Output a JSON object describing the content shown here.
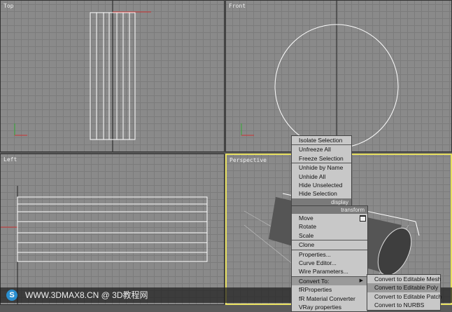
{
  "viewports": {
    "top": "Top",
    "front": "Front",
    "left": "Left",
    "perspective": "Perspective"
  },
  "menu": {
    "display_items": [
      "Isolate Selection",
      "Unfreeze All",
      "Freeze Selection",
      "Unhide by Name",
      "Unhide All",
      "Hide Unselected",
      "Hide Selection"
    ],
    "display_header": "display",
    "transform_header": "transform",
    "transform_items": [
      "Move",
      "Rotate",
      "Scale",
      "Clone",
      "Properties...",
      "Curve Editor...",
      "Wire Parameters...",
      "Convert To:",
      "fRProperties",
      "fR Material Converter",
      "VRay properties"
    ]
  },
  "submenu": [
    "Convert to Editable Mesh",
    "Convert to Editable Poly",
    "Convert to Editable Patch",
    "Convert to NURBS"
  ],
  "watermark": {
    "text": "WWW.3DMAX8.CN @ 3D教程网",
    "logo": "S"
  },
  "colors": {
    "active_border": "#e8e060",
    "viewport_bg": "#8a8a8a"
  }
}
